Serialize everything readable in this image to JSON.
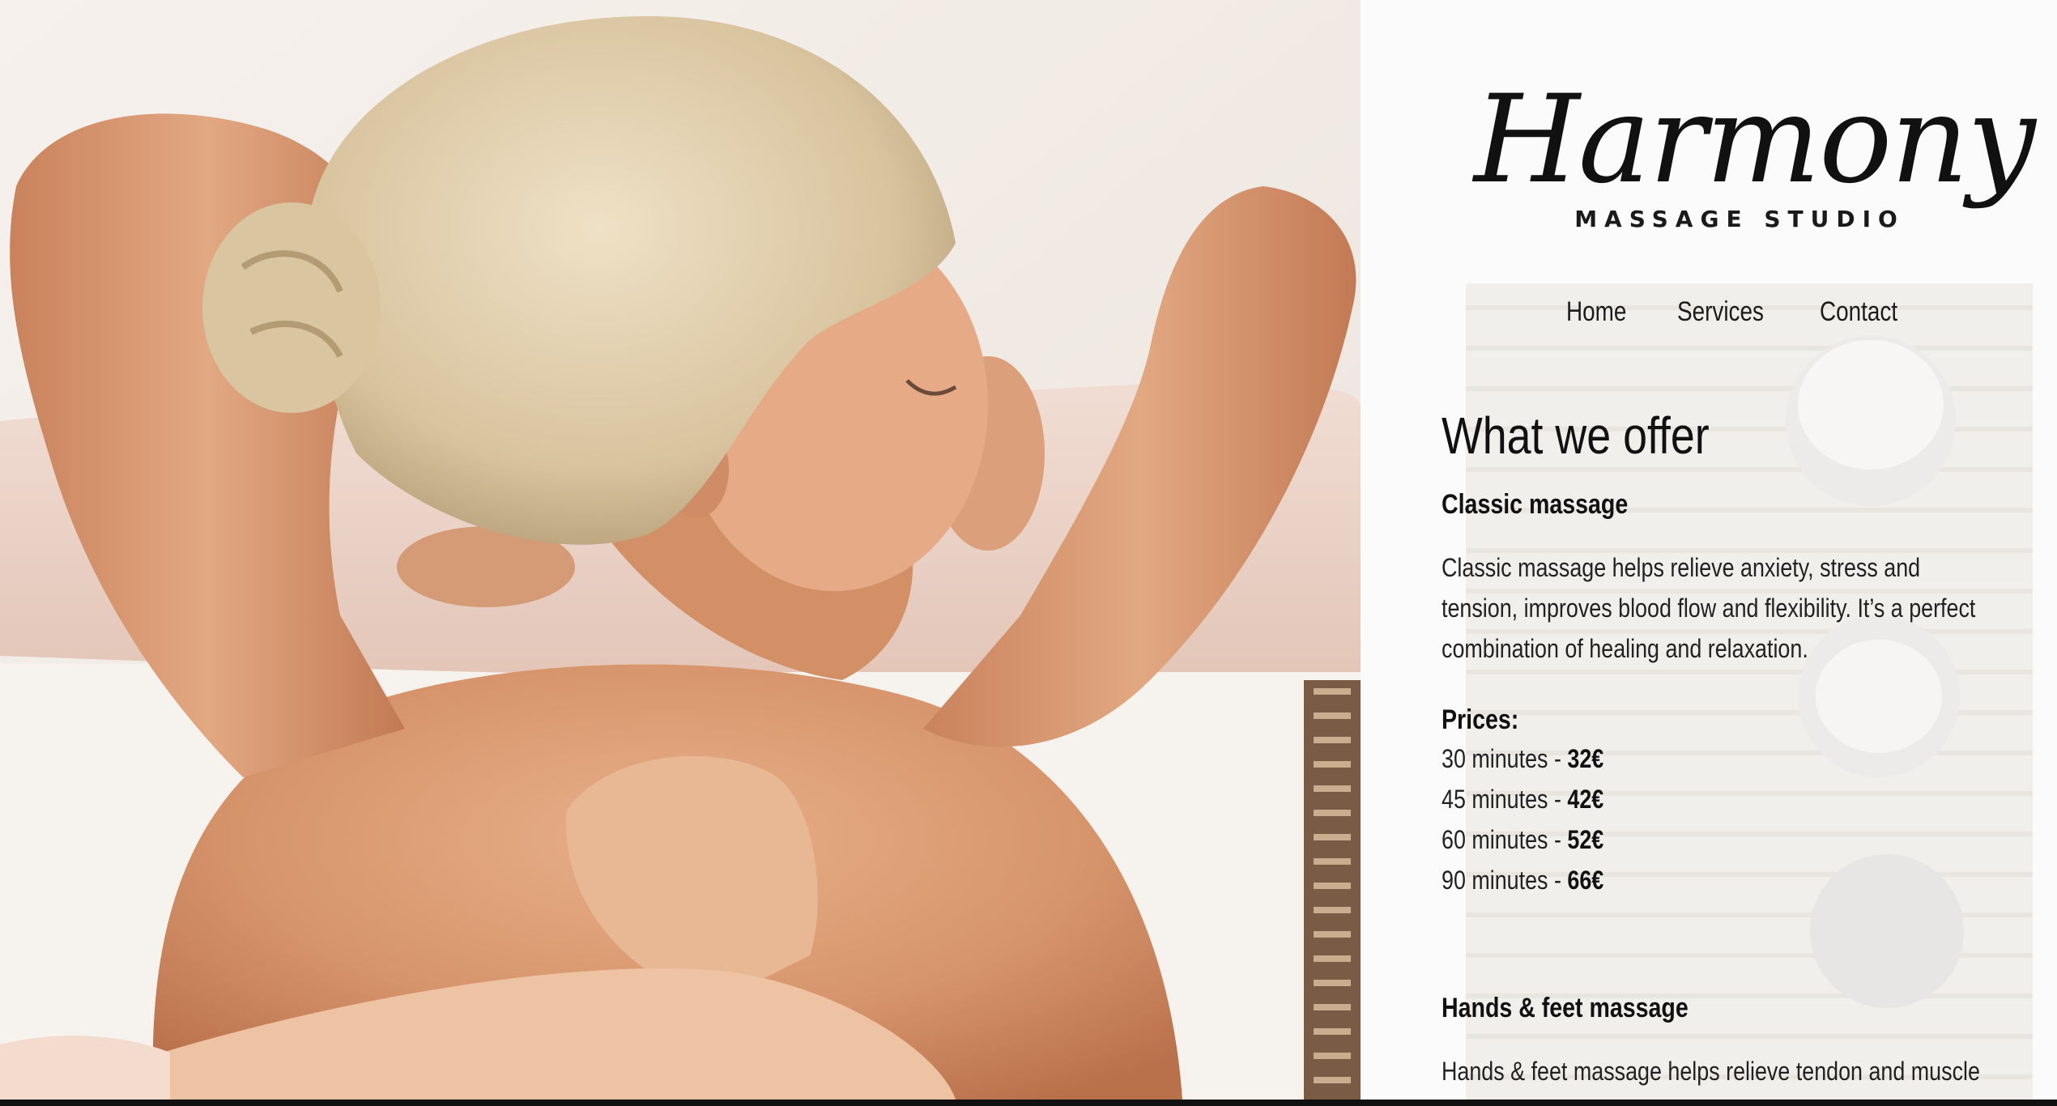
{
  "brand": {
    "script": "Harmony",
    "subtitle": "MASSAGE STUDIO"
  },
  "nav": [
    {
      "label": "Home"
    },
    {
      "label": "Services"
    },
    {
      "label": "Contact"
    }
  ],
  "section": {
    "heading": "What we offer",
    "services": [
      {
        "title": "Classic massage",
        "description": "Classic massage helps relieve anxiety, stress and tension, improves blood flow and flexibility. It’s a perfect combination of healing and relaxation.",
        "prices_label": "Prices:",
        "prices": [
          {
            "duration": "30 minutes - ",
            "price": "32€"
          },
          {
            "duration": "45 minutes - ",
            "price": "42€"
          },
          {
            "duration": "60 minutes - ",
            "price": "52€"
          },
          {
            "duration": "90 minutes - ",
            "price": "66€"
          }
        ]
      },
      {
        "title": "Hands & feet massage",
        "description": "Hands & feet massage helps relieve tendon and muscle stiffness"
      }
    ]
  },
  "colors": {
    "text": "#111111",
    "panel": "#fbfbfb",
    "skin": "#d99a72",
    "hair": "#dcc9a6"
  }
}
